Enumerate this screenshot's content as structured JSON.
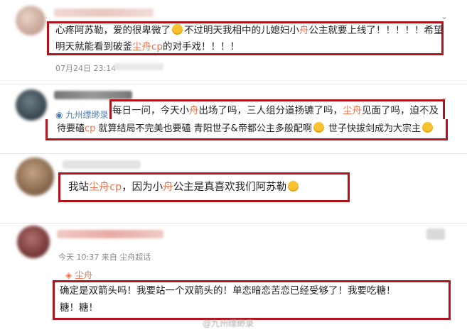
{
  "comments": [
    {
      "line1": "心疼阿苏勒，爱的很卑微了",
      "line1b": "不过明天我相中的儿媳妇小",
      "hl1": "舟",
      "line1c": "公主就要上线了！！！！！希望",
      "line2": "明天就能看到破釜",
      "hl2": "尘舟cp",
      "line2b": "的对手戏！！！！",
      "timestamp": "07月24日 23:14"
    },
    {
      "badge": "九州缥缈录",
      "line1": "每日一问，今天小",
      "hl1": "舟",
      "line1b": "出场了吗，三人组分道扬镳了吗，",
      "hl2": "尘舟",
      "line1c": "见面了吗，迫不及",
      "line2": "待要磕",
      "hl3": "cp",
      "line2b": " 就算结局不完美也要磕 青阳世子&帝都公主多般配啊",
      "line2c": " 世子快拔剑成为大宗主"
    },
    {
      "text1": "我站",
      "hl1": "尘舟cp",
      "text2": "，因为小",
      "hl2": "舟",
      "text3": "公主是真喜欢我们阿苏勒"
    },
    {
      "meta": "今天 10:37 来自 尘舟超话",
      "topic": "尘舟",
      "line1": "确定是双箭头吗！我要站一个双箭头的！单恋暗恋苦恋已经受够了！我要吃糖！",
      "line2": "糖！糖！"
    }
  ],
  "watermark": "@九州缥缈录",
  "colors": {
    "highlight": "#eb7350",
    "box": "#b1131c",
    "link": "#507daf"
  }
}
